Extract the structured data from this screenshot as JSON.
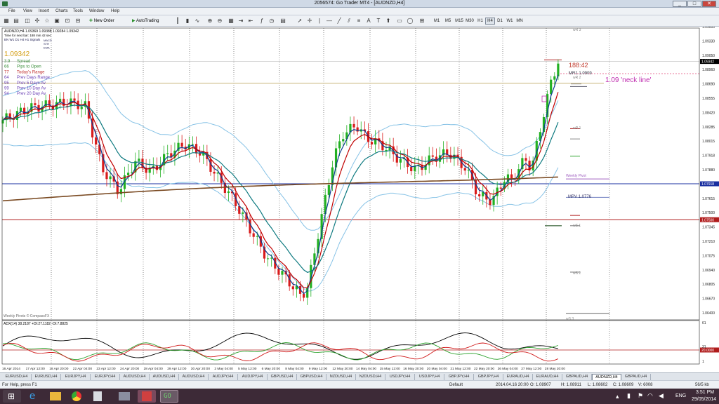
{
  "window": {
    "title": "2056574: Go Trader MT4 - [AUDNZD,H4]",
    "minimize": "_",
    "maximize": "□",
    "close": "✕"
  },
  "menu": [
    "File",
    "View",
    "Insert",
    "Charts",
    "Tools",
    "Window",
    "Help"
  ],
  "toolbar": {
    "new_order": "New Order",
    "autotrading": "AutoTrading",
    "timeframes": [
      "M1",
      "M5",
      "M15",
      "M30",
      "H1",
      "H4",
      "D1",
      "W1",
      "MN"
    ],
    "active_timeframe": "H4"
  },
  "chart": {
    "header": "AUDNZD,H4  1.09369 1.09388 1.09284 1.09342",
    "next_bar": "Time for next bar: 188 min 42 sec",
    "tf_row": "BN  W1  D1  H4  H1  Signals",
    "legend_small": [
      "MACD",
      "STR",
      "EMA"
    ],
    "current_price": "1.09342",
    "info_rows": [
      {
        "num": "3.9",
        "label": "Spread",
        "color": "#3a8f3a"
      },
      {
        "num": "66",
        "label": "Pips to Open",
        "color": "#3a8f3a"
      },
      {
        "num": "77",
        "label": "Today's Range",
        "color": "#c03030"
      },
      {
        "num": "64",
        "label": "Prev Days Range",
        "color": "#6a3fb5"
      },
      {
        "num": "95",
        "label": "Prev 5 Days Av",
        "color": "#6a3fb5"
      },
      {
        "num": "99",
        "label": "Prev 10 Day Av",
        "color": "#6a3fb5"
      },
      {
        "num": "94",
        "label": "Prev 20 Day Av",
        "color": "#6a3fb5"
      }
    ],
    "countdown": "188:42",
    "neckline_label": "1.09 'neck line'",
    "credit": "Weekly Pivots © CompassFX",
    "pivot_labels": {
      "wr3": "wR 3",
      "mr1": "MR1   1.0909",
      "wr2": "wR 2",
      "wr1": "wR 1",
      "weekly_pivot": "Weekly Pivot",
      "mpv": "MPV   1.0776",
      "ws1": "wS 1",
      "ws2": "wS 2",
      "ws3": "wS 3"
    },
    "price_scale": [
      "1.09600",
      "1.09330",
      "1.09050",
      "1.08960",
      "1.08690",
      "1.08555",
      "1.08420",
      "1.08285",
      "1.08015",
      "1.07918",
      "1.07880",
      "1.07750",
      "1.07615",
      "1.07500",
      "1.07345",
      "1.07210",
      "1.07075",
      "1.06940",
      "1.06805",
      "1.06670",
      "1.06400"
    ],
    "hline_labels": {
      "blue": "1.07918",
      "red": "1.07500",
      "current": "1.09342"
    },
    "adx_header": "ADX(14) 38.2187 +DI:27.1182 -DI:7.8825",
    "adx_scale": [
      "61",
      "31",
      "20.0000",
      "1"
    ],
    "time_axis": [
      "16 Apr 2014",
      "17 Apr 12:00",
      "18 Apr 20:00",
      "22 Apr 04:00",
      "23 Apr 12:00",
      "24 Apr 20:00",
      "28 Apr 04:00",
      "29 Apr 12:00",
      "30 Apr 20:00",
      "2 May 04:00",
      "5 May 12:00",
      "6 May 20:00",
      "8 May 04:00",
      "9 May 12:00",
      "12 May 20:00",
      "14 May 04:00",
      "15 May 12:00",
      "16 May 20:00",
      "20 May 04:00",
      "21 May 12:00",
      "22 May 20:00",
      "26 May 04:00",
      "27 May 12:00",
      "28 May 20:00"
    ]
  },
  "tabs": [
    "EURUSD,H4",
    "EURUSD,H4",
    "EURJPY,H4",
    "EURJPY,H4",
    "AUDUSD,H4",
    "AUDUSD,H4",
    "AUDUSD,H4",
    "AUDJPY,H4",
    "AUDJPY,H4",
    "GBPUSD,H4",
    "GBPUSD,H4",
    "NZDUSD,H4",
    "NZDUSD,H4",
    "USDJPY,H4",
    "USDJPY,H4",
    "GBPJPY,H4",
    "GBPJPY,H4",
    "EURAUD,H4",
    "EURAUD,H4",
    "GBPAUD,H4",
    "AUDNZD,H4",
    "GBPAUD,H4"
  ],
  "active_tab": "AUDNZD,H4",
  "status": {
    "help": "For Help, press F1",
    "profile": "Default",
    "datetime": "2014.04.16 20:00",
    "open": "O: 1.08907",
    "high": "H: 1.08911",
    "low": "L: 1.08602",
    "close": "C: 1.08609",
    "volume": "V: 6008",
    "traffic": "56/5 kb"
  },
  "taskbar": {
    "time": "3:51 PM",
    "date": "29/05/2014",
    "lang": "ENG"
  },
  "colors": {
    "bull": "#22b022",
    "bear": "#d81b1b",
    "ema_fast": "#c00000",
    "ema_mid": "#0b3d91",
    "ema_slow": "#0e7a80",
    "sma_long": "#7a4a22",
    "bollinger": "#86c2e6",
    "neckline": "#c02fb0",
    "blue_line": "#1a2fa0",
    "red_line": "#b01c1c",
    "adx": "#000000",
    "plus_di": "#2aa02a",
    "minus_di": "#d01818"
  }
}
